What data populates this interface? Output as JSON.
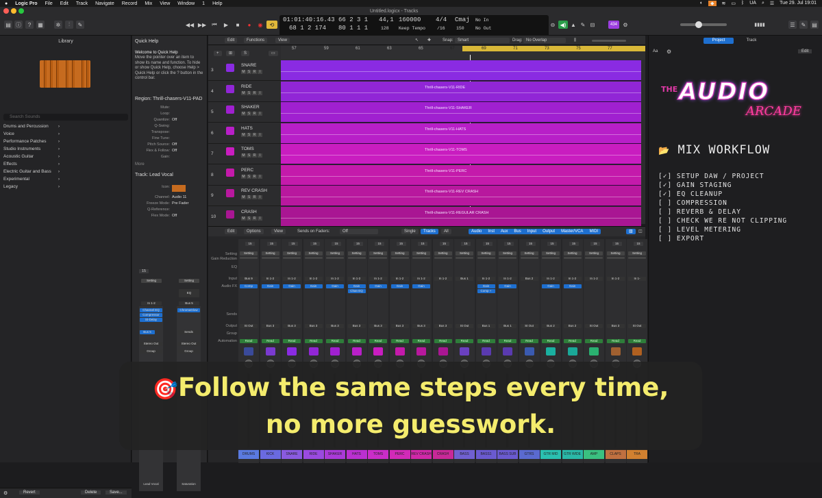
{
  "menubar": {
    "apple": "",
    "items": [
      "Logic Pro",
      "File",
      "Edit",
      "Track",
      "Navigate",
      "Record",
      "Mix",
      "View",
      "Window",
      "1",
      "Help"
    ],
    "lang": "UA",
    "clock": "Tue 29. Jul 19:01"
  },
  "window": {
    "title": "Untitled.logicx - Tracks"
  },
  "lcd": {
    "time": "01:01:40:16.43",
    "bars_top": "66  2  3     1",
    "bars_bottom": "68  1  2  174",
    "bars_bottom2": "80  1  1     1",
    "tempo_top": "44,1",
    "tempo_bottom": "128",
    "samplerate": "160000",
    "mode": "Keep Tempo",
    "sig_top": "4/4",
    "sig_bottom": "/16",
    "key_top": "Cmaj",
    "key_bottom": "150",
    "in_label": "No In",
    "out_label": "No Out"
  },
  "library": {
    "title": "Library",
    "search_placeholder": "Search Sounds",
    "categories": [
      "Drums and Percussion",
      "Voice",
      "Performance Patches",
      "Studio Instruments",
      "Acoustic Guitar",
      "Effects",
      "Electric Guitar and Bass",
      "Experimental",
      "Legacy"
    ],
    "revert": "Revert",
    "delete": "Delete",
    "save": "Save..."
  },
  "inspector": {
    "quick_help_title": "Quick Help",
    "quick_help_heading": "Welcome to Quick Help",
    "quick_help_text": "Move the pointer over an item to show its name and function. To hide or show Quick Help, choose Help > Quick Help or click the ? button in the control bar.",
    "region_title": "Region: Thrill-chasers-V11-PAD",
    "region_rows": [
      {
        "label": "Mute:",
        "value": ""
      },
      {
        "label": "Loop:",
        "value": ""
      },
      {
        "label": "Quantize:",
        "value": "Off"
      },
      {
        "label": "Q-Swing:",
        "value": ""
      },
      {
        "label": "Transpose:",
        "value": ""
      },
      {
        "label": "Fine Tune:",
        "value": ""
      },
      {
        "label": "Pitch Source:",
        "value": "Off"
      },
      {
        "label": "Flex & Follow:",
        "value": "Off"
      },
      {
        "label": "Gain:",
        "value": ""
      }
    ],
    "more": "More",
    "track_title": "Track:  Lead Vocal",
    "track_rows": [
      {
        "label": "Icon:",
        "value": ""
      },
      {
        "label": "Channel:",
        "value": "Audio 11"
      },
      {
        "label": "Freeze Mode:",
        "value": "Pre Fader"
      },
      {
        "label": "Q-Reference:",
        "value": ""
      },
      {
        "label": "Flex Mode:",
        "value": "Off"
      }
    ],
    "strip_left": {
      "setting": "Setting",
      "input": "In 1-2",
      "fx": [
        "Channel EQ",
        "Compressor",
        "St-Delay"
      ],
      "bus": "Bus 5",
      "out": "Stereo Out",
      "group": "Group",
      "name": "Lead Vocal",
      "level": "15"
    },
    "strip_right": {
      "setting": "Setting",
      "eq": "EQ",
      "input": "Bus 5",
      "fx": [
        "ChromaGlow"
      ],
      "sends": "Sends",
      "out": "Stereo Out",
      "group": "Group",
      "name": "Saturation"
    }
  },
  "tracks_toolbar": {
    "edit": "Edit",
    "functions": "Functions",
    "view": "View",
    "snap_label": "Snap:",
    "snap_value": "Smart",
    "drag_label": "Drag:",
    "drag_value": "No Overlap"
  },
  "ruler": {
    "bars": [
      "57",
      "59",
      "61",
      "63",
      "65",
      "67",
      "69",
      "71",
      "73",
      "75",
      "77"
    ]
  },
  "tracks": [
    {
      "num": "3",
      "name": "SNARE",
      "region": "",
      "color": "#8a2be2"
    },
    {
      "num": "4",
      "name": "RIDE",
      "region": "Thrill-chasers-V11-RIDE",
      "color": "#9126d6"
    },
    {
      "num": "5",
      "name": "SHAKER",
      "region": "Thrill-chasers-V11-SHAKER",
      "color": "#a020d0"
    },
    {
      "num": "6",
      "name": "HATS",
      "region": "Thrill-chasers-V11-HATS",
      "color": "#b81fc8"
    },
    {
      "num": "7",
      "name": "TOMS",
      "region": "Thrill-chasers-V11-TOMS",
      "color": "#c91dc0"
    },
    {
      "num": "8",
      "name": "PERC",
      "region": "Thrill-chasers-V11-PERC",
      "color": "#c41aab"
    },
    {
      "num": "9",
      "name": "REV CRASH",
      "region": "Thrill-chasers-V11-REV CRASH",
      "color": "#b8189e"
    },
    {
      "num": "10",
      "name": "CRASH",
      "region": "Thrill-chasers-V11-REGULAR CRASH",
      "color": "#a91693"
    }
  ],
  "mixer_toolbar": {
    "edit": "Edit",
    "options": "Options",
    "view": "View",
    "sends_label": "Sends on Faders:",
    "sends_value": "Off",
    "single": "Single",
    "tracks": "Tracks",
    "all": "All",
    "filters": [
      "Audio",
      "Inst",
      "Aux",
      "Bus",
      "Input",
      "Output",
      "Master/VCA",
      "MIDI"
    ]
  },
  "mixer_labels": {
    "setting": "Setting",
    "gain": "Gain Reduction",
    "eq": "EQ",
    "input": "Input",
    "fx": "Audio FX",
    "sends": "Sends",
    "output": "Output",
    "group": "Group",
    "automation": "Automation"
  },
  "mixer_strips": [
    {
      "name": "DRUMS",
      "level": "15",
      "input": "Bus 9",
      "fx": [
        "Comp"
      ],
      "out": "St Out",
      "auto": "Read",
      "color": "#5a7ae0",
      "icon": "#3a4a9a"
    },
    {
      "name": "KICK",
      "level": "15",
      "input": "In 1-2",
      "fx": [
        "Gain"
      ],
      "out": "Bus 3",
      "auto": "Read",
      "color": "#6a6ae0",
      "icon": "#7a3ad0"
    },
    {
      "name": "SNARE",
      "level": "15",
      "input": "In 1-2",
      "fx": [
        "Gain"
      ],
      "out": "Bus 3",
      "auto": "Read",
      "color": "#8a5ae0",
      "icon": "#8a2be2"
    },
    {
      "name": "RIDE",
      "level": "15",
      "input": "In 1-2",
      "fx": [
        "Gain"
      ],
      "out": "Bus 3",
      "auto": "Read",
      "color": "#9a4ae0",
      "icon": "#9126d6"
    },
    {
      "name": "SHAKER",
      "level": "15",
      "input": "In 1-2",
      "fx": [
        "Gain"
      ],
      "out": "Bus 3",
      "auto": "Read",
      "color": "#aa3ad8",
      "icon": "#a020d0"
    },
    {
      "name": "HATS",
      "level": "15",
      "input": "In 1-2",
      "fx": [
        "Gain",
        "Chan EQ"
      ],
      "out": "Bus 3",
      "auto": "Read",
      "color": "#ba30d0",
      "icon": "#b81fc8"
    },
    {
      "name": "TOMS",
      "level": "15",
      "input": "In 1-2",
      "fx": [
        "Gain"
      ],
      "out": "Bus 3",
      "auto": "Read",
      "color": "#ca2dc8",
      "icon": "#c91dc0"
    },
    {
      "name": "PERC",
      "level": "15",
      "input": "In 1-2",
      "fx": [
        "Gain"
      ],
      "out": "Bus 3",
      "auto": "Read",
      "color": "#d22ab8",
      "icon": "#c41aab"
    },
    {
      "name": "REV CRASH",
      "level": "15",
      "input": "In 1-2",
      "fx": [
        "Gain"
      ],
      "out": "Bus 3",
      "auto": "Read",
      "color": "#d028a8",
      "icon": "#b8189e"
    },
    {
      "name": "CRASH",
      "level": "15",
      "input": "In 1-2",
      "fx": [],
      "out": "Bus 3",
      "auto": "Read",
      "color": "#c82898",
      "icon": "#a91693"
    },
    {
      "name": "BASS",
      "level": "15",
      "input": "Bus 1",
      "fx": [],
      "out": "St Out",
      "auto": "Read",
      "color": "#7060d0",
      "icon": "#6a40c0"
    },
    {
      "name": "BASS1",
      "level": "15",
      "input": "In 1-2",
      "fx": [
        "Gain",
        "Comp +"
      ],
      "out": "Bus 1",
      "auto": "Read",
      "color": "#6a5ad0",
      "icon": "#5a3ab0"
    },
    {
      "name": "BASS SUB",
      "level": "15",
      "input": "In 1-2",
      "fx": [
        "Gain"
      ],
      "out": "Bus 1",
      "auto": "Read",
      "color": "#6a5ad0",
      "icon": "#5a3ab0"
    },
    {
      "name": "GTRS",
      "level": "15",
      "input": "Bus 2",
      "fx": [],
      "out": "St Out",
      "auto": "Read",
      "color": "#5a6ad0",
      "icon": "#3a5ab0"
    },
    {
      "name": "GTR MID",
      "level": "15",
      "input": "In 1-2",
      "fx": [
        "Gain"
      ],
      "out": "Bus 2",
      "auto": "Read",
      "color": "#2ac0b0",
      "icon": "#1ab0a0"
    },
    {
      "name": "GTR WIDE",
      "level": "15",
      "input": "In 1-2",
      "fx": [
        "Gain"
      ],
      "out": "Bus 2",
      "auto": "Read",
      "color": "#2ab8a8",
      "icon": "#1aa898"
    },
    {
      "name": "AMP",
      "level": "15",
      "input": "In 1-2",
      "fx": [],
      "out": "St Out",
      "auto": "Read",
      "color": "#3ac080",
      "icon": "#2ab070"
    },
    {
      "name": "CLAPS",
      "level": "15",
      "input": "In 1-2",
      "fx": [],
      "out": "Bus 3",
      "auto": "Read",
      "color": "#c07040",
      "icon": "#a06030"
    },
    {
      "name": "TRA",
      "level": "15",
      "input": "In 1-",
      "fx": [],
      "out": "St Out",
      "auto": "Read",
      "color": "#d08030",
      "icon": "#b06020"
    }
  ],
  "right_panel": {
    "tab_project": "Project",
    "tab_track": "Track",
    "aa": "Aa",
    "edit": "Edit",
    "logo_small": "THE",
    "logo_main": "AUDIO",
    "logo_script": "ARCADE",
    "title": "MIX WORKFLOW",
    "checklist": [
      {
        "text": "[✓] SETUP DAW / PROJECT"
      },
      {
        "text": "[✓] GAIN STAGING"
      },
      {
        "text": "[✓] EQ CLEANUP"
      },
      {
        "text": "[ ] COMPRESSION"
      },
      {
        "text": "[ ] REVERB & DELAY"
      },
      {
        "text": "[ ] CHECK WE RE NOT CLIPPING"
      },
      {
        "text": "[ ] LEVEL METERING"
      },
      {
        "text": "[ ] EXPORT"
      }
    ]
  },
  "caption": {
    "emoji": "🎯",
    "line1": "Follow the same steps every time,",
    "line2": "no more guesswork."
  }
}
